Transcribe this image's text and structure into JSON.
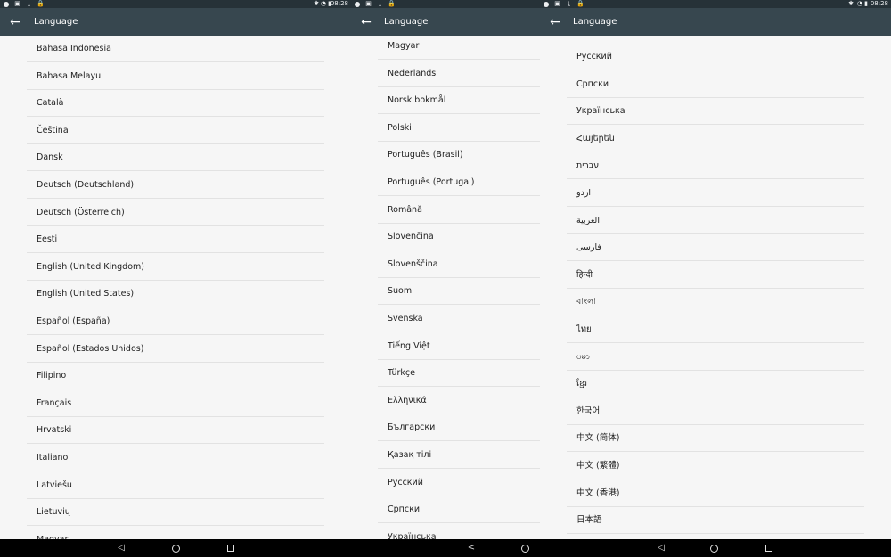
{
  "status_bar": {
    "time": "08:28",
    "icons_left": [
      "circle-icon",
      "image-icon",
      "download-icon",
      "lock-icon"
    ],
    "icons_right": [
      "bluetooth-icon",
      "alarm-icon",
      "battery-icon"
    ]
  },
  "panels": [
    {
      "title": "Language",
      "items": [
        "Bahasa Indonesia",
        "Bahasa Melayu",
        "Català",
        "Čeština",
        "Dansk",
        "Deutsch (Deutschland)",
        "Deutsch (Österreich)",
        "Eesti",
        "English (United Kingdom)",
        "English (United States)",
        "Español (España)",
        "Español (Estados Unidos)",
        "Filipino",
        "Français",
        "Hrvatski",
        "Italiano",
        "Latviešu",
        "Lietuvių",
        "Magyar"
      ]
    },
    {
      "title": "Language",
      "items": [
        "Magyar",
        "Nederlands",
        "Norsk bokmål",
        "Polski",
        "Português (Brasil)",
        "Português (Portugal)",
        "Română",
        "Slovenčina",
        "Slovenščina",
        "Suomi",
        "Svenska",
        "Tiếng Việt",
        "Türkçe",
        "Ελληνικά",
        "Български",
        "Қазақ тілі",
        "Русский",
        "Српски",
        "Українська"
      ]
    },
    {
      "title": "Language",
      "items": [
        "Русский",
        "Српски",
        "Українська",
        "Հայերեն",
        "עברית",
        "اردو",
        "العربية",
        "فارسی",
        "हिन्दी",
        "বাংলা",
        "ไทย",
        "ဗမာ",
        "ខ្មែរ",
        "한국어",
        "中文 (简体)",
        "中文 (繁體)",
        "中文 (香港)",
        "日本語"
      ]
    }
  ],
  "nav": {
    "back_glyph": "◁",
    "home_glyph": "",
    "recents_glyph": ""
  },
  "colors": {
    "status_bar": "#263238",
    "app_bar": "#37474f",
    "background": "#f6f6f6",
    "text": "#212121",
    "divider": "#e2e2e2",
    "nav_bar": "#000000"
  }
}
